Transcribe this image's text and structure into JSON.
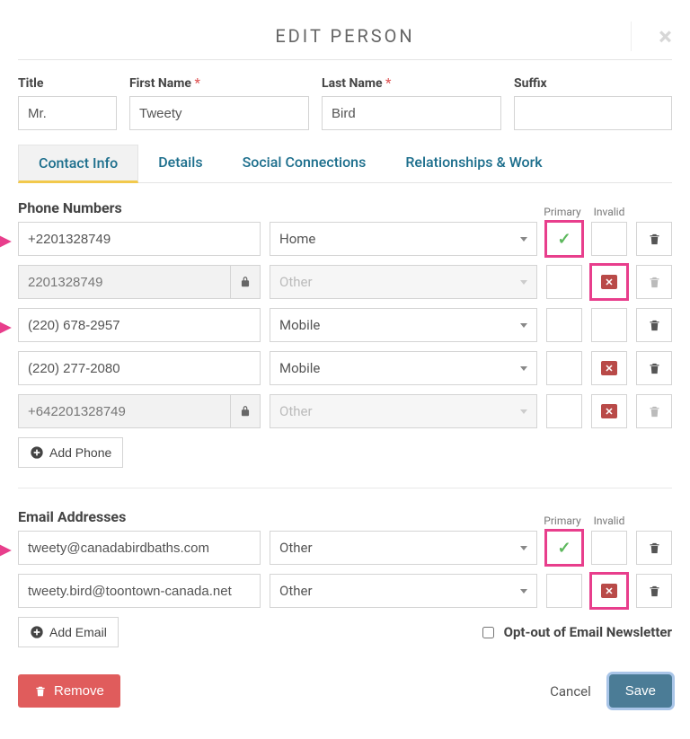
{
  "header": {
    "title": "EDIT PERSON"
  },
  "labels": {
    "title": "Title",
    "first_name": "First Name",
    "last_name": "Last Name",
    "suffix": "Suffix",
    "primary": "Primary",
    "invalid": "Invalid",
    "phones_heading": "Phone Numbers",
    "emails_heading": "Email Addresses",
    "add_phone": "Add Phone",
    "add_email": "Add Email",
    "opt_out": "Opt-out of Email Newsletter"
  },
  "fields": {
    "title": "Mr.",
    "first_name": "Tweety",
    "last_name": "Bird",
    "suffix": ""
  },
  "tabs": {
    "contact_info": "Contact Info",
    "details": "Details",
    "social": "Social Connections",
    "relationships": "Relationships & Work"
  },
  "phones": [
    {
      "value": "+2201328749",
      "type": "Home",
      "locked": false,
      "primary": true,
      "invalid": false,
      "pink_primary": true,
      "pink_invalid": false,
      "trash_enabled": true,
      "arrow": true
    },
    {
      "value": "2201328749",
      "type": "Other",
      "locked": true,
      "primary": false,
      "invalid": true,
      "pink_primary": false,
      "pink_invalid": true,
      "trash_enabled": false,
      "arrow": false
    },
    {
      "value": "(220) 678-2957",
      "type": "Mobile",
      "locked": false,
      "primary": false,
      "invalid": false,
      "pink_primary": false,
      "pink_invalid": false,
      "trash_enabled": true,
      "arrow": true
    },
    {
      "value": "(220) 277-2080",
      "type": "Mobile",
      "locked": false,
      "primary": false,
      "invalid": true,
      "pink_primary": false,
      "pink_invalid": false,
      "trash_enabled": true,
      "arrow": false
    },
    {
      "value": "+642201328749",
      "type": "Other",
      "locked": true,
      "primary": false,
      "invalid": true,
      "pink_primary": false,
      "pink_invalid": false,
      "trash_enabled": false,
      "arrow": false
    }
  ],
  "emails": [
    {
      "value": "tweety@canadabirdbaths.com",
      "type": "Other",
      "primary": true,
      "invalid": false,
      "pink_primary": true,
      "pink_invalid": false,
      "arrow": true
    },
    {
      "value": "tweety.bird@toontown-canada.net",
      "type": "Other",
      "primary": false,
      "invalid": true,
      "pink_primary": false,
      "pink_invalid": true,
      "arrow": false
    }
  ],
  "opt_out_checked": false,
  "footer": {
    "remove": "Remove",
    "cancel": "Cancel",
    "save": "Save"
  }
}
